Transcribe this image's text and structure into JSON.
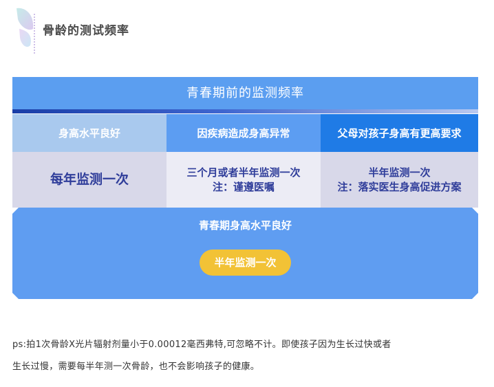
{
  "header": {
    "title": "骨龄的测试频率"
  },
  "panel": {
    "title": "青春期前的监测频率",
    "columns": [
      {
        "heading": "身高水平良好",
        "line1": "每年监测一次",
        "line2": ""
      },
      {
        "heading": "因疾病造成身高异常",
        "line1": "三个月或者半年监测一次",
        "line2": "注：谨遵医嘱"
      },
      {
        "heading": "父母对孩子身高有更高要求",
        "line1": "半年监测一次",
        "line2": "注：落实医生身高促进方案"
      }
    ],
    "puberty": {
      "title": "青春期身高水平良好",
      "frequency": "半年监测一次"
    }
  },
  "note": {
    "line1": "ps:拍1次骨龄X光片辐射剂量小于0.00012毫西弗特,可忽略不计。即使孩子因为生长过快或者",
    "line2": "生长过慢，需要每半年测一次骨龄，也不会影响孩子的健康。"
  },
  "colors": {
    "title_bar": "#5b9ef0",
    "header1": "#a9c9ee",
    "header2": "#5c9df2",
    "header3": "#1f7be6",
    "cell_text": "#2f3d9a",
    "pill": "#f2c236"
  },
  "icons": {
    "header_decoration": "butterfly-wing-icon"
  }
}
